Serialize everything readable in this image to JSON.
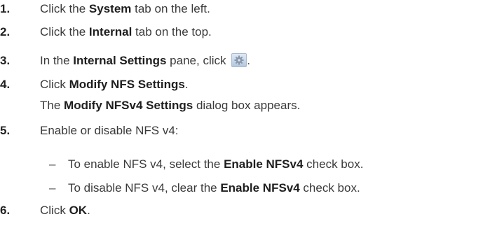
{
  "steps": [
    {
      "num": "1.",
      "pre": "Click the ",
      "bold": "System",
      "post": " tab on the left."
    },
    {
      "num": "2.",
      "pre": "Click the ",
      "bold": "Internal",
      "post": " tab on the top."
    },
    {
      "num": "3.",
      "pre": "In the ",
      "bold": "Internal Settings",
      "post": " pane, click ",
      "end": ".",
      "icon": "gear-icon"
    },
    {
      "num": "4.",
      "pre": "Click ",
      "bold": "Modify NFS Settings",
      "post": "."
    },
    {
      "num": "5.",
      "text": "Enable or disable NFS v4:"
    },
    {
      "num": "6.",
      "pre": "Click ",
      "bold": "OK",
      "post": "."
    }
  ],
  "step4_note": {
    "pre": "The ",
    "bold": "Modify NFSv4 Settings",
    "post": " dialog box appears."
  },
  "step5_bullets": [
    {
      "dash": "–",
      "pre": "To enable NFS v4, select the ",
      "bold": "Enable NFSv4",
      "post": " check box."
    },
    {
      "dash": "–",
      "pre": "To disable NFS v4, clear the ",
      "bold": "Enable NFSv4",
      "post": " check box."
    }
  ]
}
